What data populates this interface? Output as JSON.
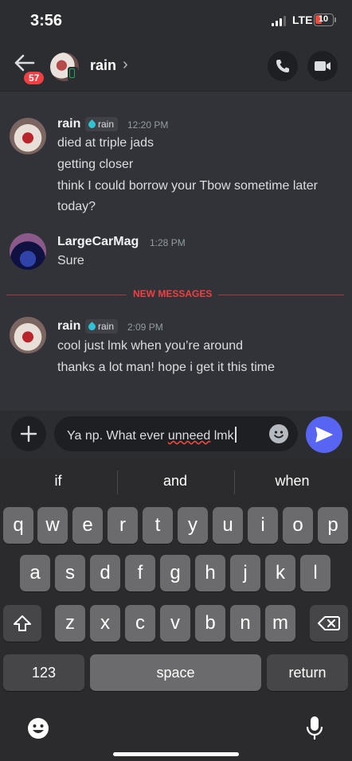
{
  "status": {
    "time": "3:56",
    "network": "LTE",
    "battery": "10"
  },
  "header": {
    "back_badge": "57",
    "title": "rain",
    "chevron": "›"
  },
  "messages": [
    {
      "author": "rain",
      "tag": "rain",
      "time": "12:20 PM",
      "lines": [
        "died at triple jads",
        "getting closer",
        "think I could borrow your Tbow sometime later today?"
      ]
    },
    {
      "author": "LargeCarMag",
      "time": "1:28 PM",
      "lines": [
        "Sure"
      ]
    },
    {
      "author": "rain",
      "tag": "rain",
      "time": "2:09 PM",
      "lines": [
        "cool just lmk when you’re around",
        "thanks a lot man! hope i get it this time"
      ]
    }
  ],
  "divider": "NEW MESSAGES",
  "composer": {
    "text_before": "Ya np. What ever ",
    "misspelled": "unneed",
    "text_after": " lmk"
  },
  "keyboard": {
    "suggestions": [
      "if",
      "and",
      "when"
    ],
    "row1": [
      "q",
      "w",
      "e",
      "r",
      "t",
      "y",
      "u",
      "i",
      "o",
      "p"
    ],
    "row2": [
      "a",
      "s",
      "d",
      "f",
      "g",
      "h",
      "j",
      "k",
      "l"
    ],
    "row3": [
      "z",
      "x",
      "c",
      "v",
      "b",
      "n",
      "m"
    ],
    "numbers": "123",
    "space": "space",
    "return": "return"
  },
  "colors": {
    "accent": "#5865f2",
    "new_messages": "#f23f43",
    "badge": "#f23f43"
  },
  "icons": [
    "back-arrow-icon",
    "chevron-right-icon",
    "phone-icon",
    "video-camera-icon",
    "plus-icon",
    "emoji-icon",
    "send-icon",
    "shift-icon",
    "backspace-icon",
    "keyboard-emoji-icon",
    "microphone-icon"
  ]
}
